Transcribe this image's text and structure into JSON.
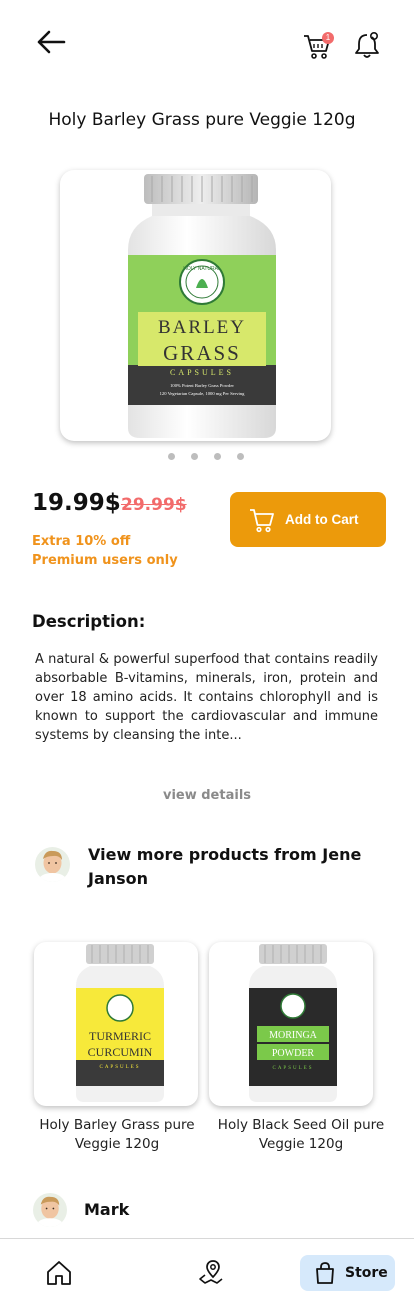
{
  "header": {
    "cart_badge": "1"
  },
  "product": {
    "title": "Holy Barley Grass pure Veggie 120g",
    "image": {
      "brand": "HOLY NATURAL",
      "line1": "BARLEY",
      "line2": "GRASS",
      "caps": "CAPSULES",
      "detail1": "100% Potent Barley Grass Powder",
      "detail2": "120 Vegetarian Capsule, 1000 mg Per Serving",
      "label_color": "#8fd05a",
      "band_color": "#d7e86b"
    },
    "price": "19.99$",
    "old_price": "29.99$",
    "promo_line1": "Extra 10% off",
    "promo_line2": "Premium users only",
    "add_to_cart_label": "Add to Cart"
  },
  "description": {
    "title": "Description:",
    "text": "A natural & powerful superfood that contains readily absorbable B-vitamins, minerals, iron, protein and over 18 amino acids. It contains chlorophyll and is known to support the cardiovascular and immune systems by cleansing the inte...",
    "view_details": "view details"
  },
  "seller": {
    "text": "View more products from Jene Janson"
  },
  "related": [
    {
      "name": "Holy Barley Grass pure Veggie 120g",
      "image_line1": "TURMERIC",
      "image_line2": "CURCUMIN",
      "image_caps": "CAPSULES",
      "label_color": "#f7e93a"
    },
    {
      "name": "Holy Black Seed Oil pure Veggie 120g",
      "image_line1": "MORINGA",
      "image_line2": "POWDER",
      "image_caps": "CAPSULES",
      "label_color": "#2a2a2a"
    }
  ],
  "review": {
    "name": "Mark"
  },
  "bottom_nav": {
    "home_icon": "home-icon",
    "map_icon": "map-pin-icon",
    "store_label": "Store",
    "active_color": "#d6e9fb"
  },
  "colors": {
    "accent": "#ec9a0b",
    "promo": "#f0931c",
    "strike": "#f26b6b"
  }
}
